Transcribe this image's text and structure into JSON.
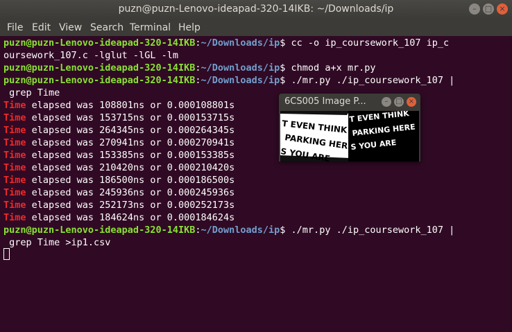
{
  "window": {
    "title": "puzn@puzn-Lenovo-ideapad-320-14IKB: ~/Downloads/ip",
    "buttons": {
      "minimize": "–",
      "maximize": "□",
      "close": "×"
    }
  },
  "menu": [
    "File",
    "Edit",
    "View",
    "Search",
    "Terminal",
    "Help"
  ],
  "terminal": {
    "prompt_user": "puzn@puzn-Lenovo-ideapad-320-14IKB",
    "prompt_sep": ":",
    "prompt_path": "~/Downloads/ip",
    "prompt_dollar": "$",
    "cmd1_a": " cc -o ip_coursework_107 ip_c",
    "cmd1_b": "oursework_107.c -lglut -lGL -lm",
    "cmd2": " chmod a+x mr.py",
    "cmd3_a": " ./mr.py ./ip_coursework_107 |",
    "cmd3_b": " grep Time",
    "match_word": "Time",
    "outputs": [
      " elapsed was 108801ns or 0.000108801s",
      " elapsed was 153715ns or 0.000153715s",
      " elapsed was 264345ns or 0.000264345s",
      " elapsed was 270941ns or 0.000270941s",
      " elapsed was 153385ns or 0.000153385s",
      " elapsed was 210420ns or 0.000210420s",
      " elapsed was 186500ns or 0.000186500s",
      " elapsed was 245936ns or 0.000245936s",
      " elapsed was 252173ns or 0.000252173s",
      " elapsed was 184624ns or 0.000184624s"
    ],
    "cmd4_a": " ./mr.py ./ip_coursework_107 |",
    "cmd4_b": " grep Time >ip1.csv"
  },
  "image_window": {
    "title": "6CS005 Image P...",
    "buttons": {
      "minimize": "–",
      "maximize": "□",
      "close": "×"
    },
    "image_text": {
      "left_1": "T EVEN THINK",
      "left_2": "PARKING HERE",
      "left_3": "S YOU ARE",
      "right_1": "T EVEN THINK",
      "right_2": "PARKING HERE",
      "right_3": "S YOU ARE"
    }
  }
}
